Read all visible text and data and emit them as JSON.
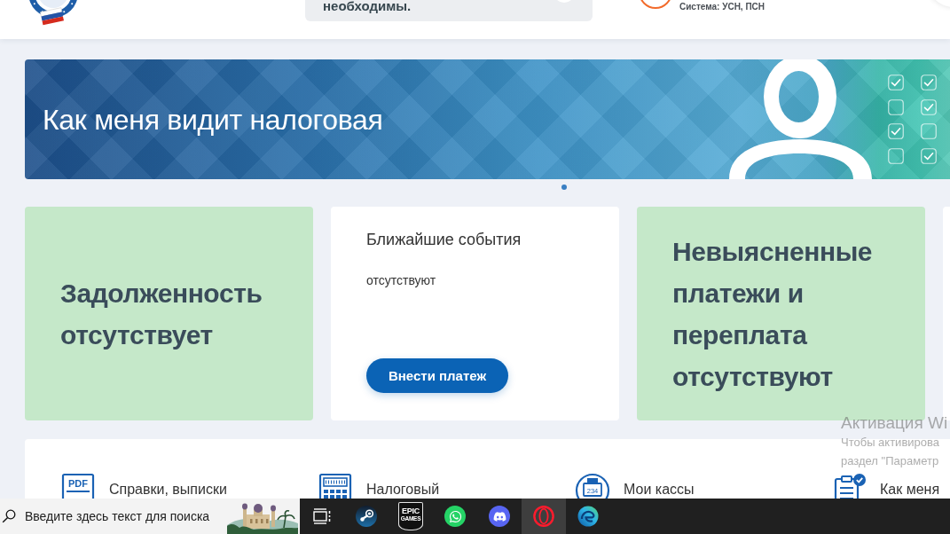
{
  "header": {
    "notice": "необходимы.",
    "tax_system": "Система: УСН, ПСН"
  },
  "banner": {
    "title": "Как меня видит налоговая",
    "checkboxes": [
      {
        "checked": true
      },
      {
        "checked": true
      },
      {
        "checked": false
      },
      {
        "checked": true
      },
      {
        "checked": true
      },
      {
        "checked": false
      },
      {
        "checked": false
      },
      {
        "checked": true
      }
    ]
  },
  "carousel": {
    "dots": [
      {
        "selected": true
      }
    ]
  },
  "cards": [
    {
      "kind": "status",
      "text": "Задолженность отсутствует"
    },
    {
      "kind": "events",
      "title": "Ближайшие события",
      "text": "отсутствуют",
      "button": "Внести платеж"
    },
    {
      "kind": "status",
      "text": "Невыясненные платежи и переплата отсутствуют"
    },
    {
      "kind": "blank"
    }
  ],
  "shortcuts": [
    {
      "kind": "pdf",
      "icon_text": "PDF",
      "label": "Справки, выписки"
    },
    {
      "kind": "calculator",
      "label": "Налоговый"
    },
    {
      "kind": "register",
      "icon_text": "234",
      "label": "Мои кассы"
    },
    {
      "kind": "clipboard",
      "label": "Как меня"
    }
  ],
  "activation_notice": {
    "title": "Активация Wi",
    "message_lines": [
      "Чтобы активирова",
      "раздел \"Параметр"
    ]
  },
  "taskbar": {
    "search": {
      "placeholder": "Введите здесь текст для поиска"
    },
    "apps": [
      {
        "kind": "task-view",
        "selected": false
      },
      {
        "kind": "steam",
        "selected": false
      },
      {
        "kind": "epic",
        "selected": false,
        "logo_lines": [
          "EPIC",
          "GAMES"
        ]
      },
      {
        "kind": "whatsapp",
        "selected": false
      },
      {
        "kind": "discord",
        "selected": false
      },
      {
        "kind": "opera",
        "selected": true
      },
      {
        "kind": "edge",
        "selected": false
      }
    ]
  }
}
